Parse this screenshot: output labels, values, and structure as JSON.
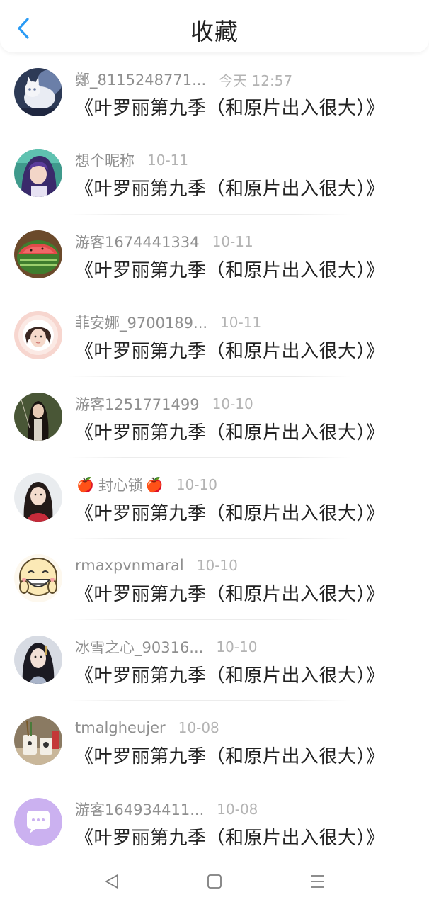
{
  "header": {
    "title": "收藏"
  },
  "work_title": "《叶罗丽第九季（和原片出入很大）》",
  "items": [
    {
      "user": "鄭_8115248771...",
      "time": "今天 12:57",
      "avatar": "cat-photo"
    },
    {
      "user": "想个昵称",
      "time": "10-11",
      "avatar": "anime-girl-purple"
    },
    {
      "user": "游客1674441334",
      "time": "10-11",
      "avatar": "watermelon"
    },
    {
      "user": "菲安娜_9700189...",
      "time": "10-11",
      "avatar": "girl-pink-frame"
    },
    {
      "user": "游客1251771499",
      "time": "10-10",
      "avatar": "girl-forest"
    },
    {
      "user": "封心锁",
      "time": "10-10",
      "avatar": "girl-portrait",
      "prefix_emoji": "🍎",
      "suffix_emoji": "🍎"
    },
    {
      "user": "rmaxpvnmaral",
      "time": "10-10",
      "avatar": "smiley-face"
    },
    {
      "user": "冰雪之心_90316...",
      "time": "10-10",
      "avatar": "anime-girl-dark"
    },
    {
      "user": "tmalgheujer",
      "time": "10-08",
      "avatar": "cups-photo"
    },
    {
      "user": "游客164934411...",
      "time": "10-08",
      "avatar": "default-chat-icon"
    }
  ]
}
